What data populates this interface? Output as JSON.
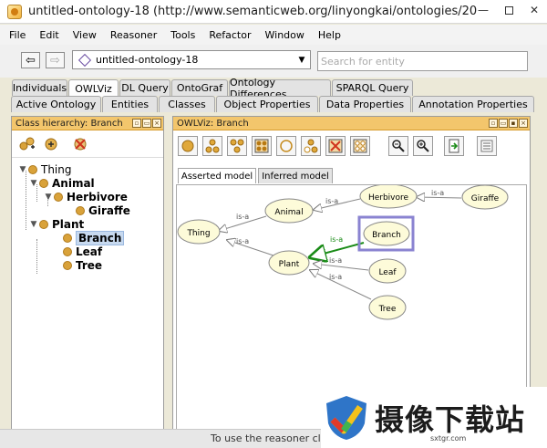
{
  "window": {
    "title": "untitled-ontology-18 (http://www.semanticweb.org/linyongkai/ontologies/2014/1/un...",
    "minimize_label": "—",
    "close_label": "✕"
  },
  "menu": [
    "File",
    "Edit",
    "View",
    "Reasoner",
    "Tools",
    "Refactor",
    "Window",
    "Help"
  ],
  "nav": {
    "back_glyph": "⇦",
    "forward_glyph": "⇨",
    "ontology_selected": "untitled-ontology-18",
    "search_placeholder": "Search for entity"
  },
  "tabs_row1": [
    "Individuals",
    "OWLViz",
    "DL Query",
    "OntoGraf",
    "Ontology Differences",
    "SPARQL Query"
  ],
  "tabs_row2": [
    "Active Ontology",
    "Entities",
    "Classes",
    "Object Properties",
    "Data Properties",
    "Annotation Properties"
  ],
  "active_tab": "OWLViz",
  "class_hierarchy": {
    "header": "Class hierarchy: Branch",
    "tree": [
      {
        "label": "Thing",
        "expander": "▼"
      },
      {
        "label": "Animal",
        "expander": "▼"
      },
      {
        "label": "Herbivore",
        "expander": "▼"
      },
      {
        "label": "Giraffe",
        "expander": ""
      },
      {
        "label": "Plant",
        "expander": "▼"
      },
      {
        "label": "Branch",
        "expander": "",
        "selected": true
      },
      {
        "label": "Leaf",
        "expander": ""
      },
      {
        "label": "Tree",
        "expander": ""
      }
    ]
  },
  "owlviz": {
    "header": "OWLViz: Branch",
    "model_tabs": [
      "Asserted model",
      "Inferred model"
    ],
    "active_model_tab": "Asserted model",
    "nodes": [
      "Thing",
      "Animal",
      "Herbivore",
      "Giraffe",
      "Branch",
      "Plant",
      "Leaf",
      "Tree"
    ],
    "selected_node": "Branch",
    "edge_label": "is-a",
    "node_fill": "#fdfbd9",
    "highlight_color": "#8a83d1",
    "selected_edge_color": "#1a8b17"
  },
  "status": {
    "text": "To use the reasoner click R"
  },
  "watermark": {
    "brand": "摄像下载站",
    "url": "sxtgr.com"
  },
  "colors": {
    "panel_header": "#f3c66c",
    "class_node": "#d9a23a"
  }
}
